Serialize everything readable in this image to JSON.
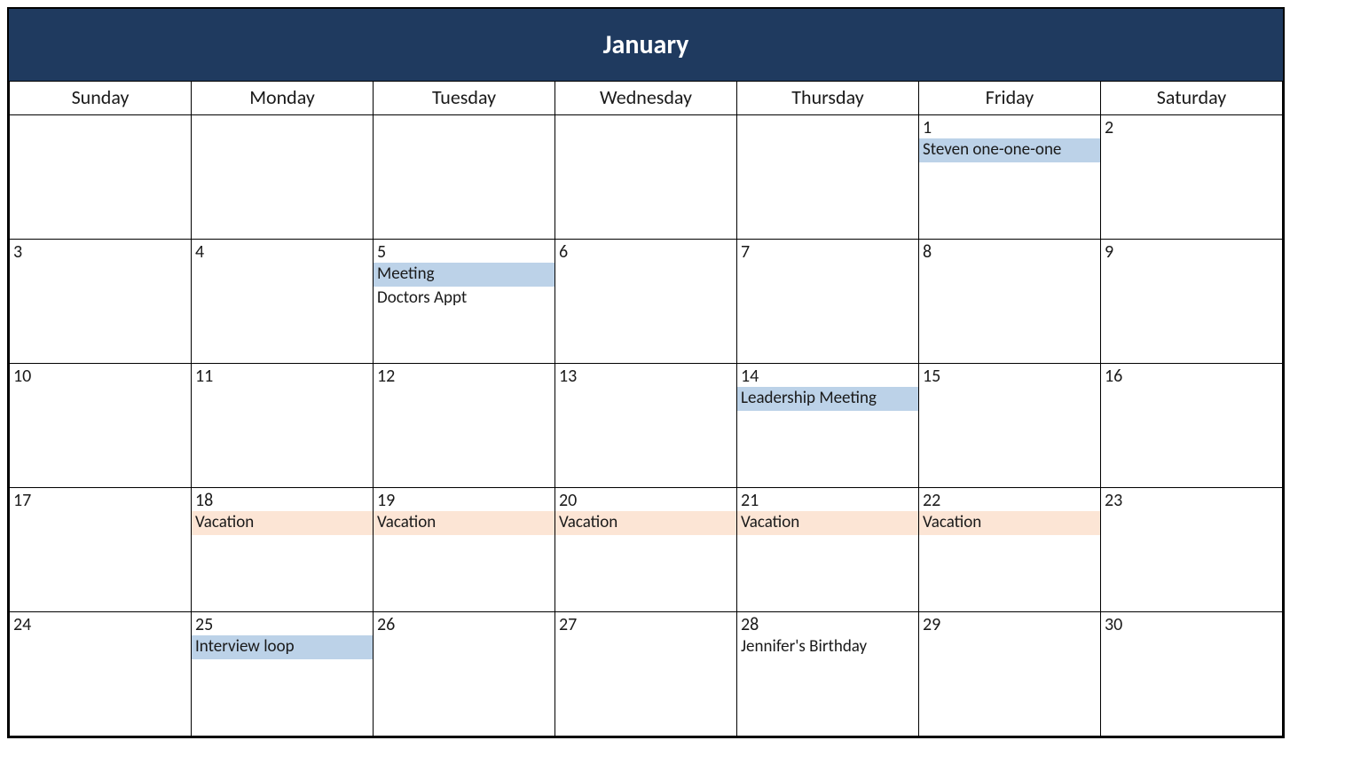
{
  "month": "January",
  "weekdays": [
    "Sunday",
    "Monday",
    "Tuesday",
    "Wednesday",
    "Thursday",
    "Friday",
    "Saturday"
  ],
  "colors": {
    "header_bg": "#1f3a5f",
    "event_blue": "#bcd2e8",
    "event_orange": "#fce5d5"
  },
  "weeks": [
    [
      {
        "day": "",
        "events": []
      },
      {
        "day": "",
        "events": []
      },
      {
        "day": "",
        "events": []
      },
      {
        "day": "",
        "events": []
      },
      {
        "day": "",
        "events": []
      },
      {
        "day": "1",
        "events": [
          {
            "label": "Steven one-one-one",
            "color": "blue"
          }
        ]
      },
      {
        "day": "2",
        "events": []
      }
    ],
    [
      {
        "day": "3",
        "events": []
      },
      {
        "day": "4",
        "events": []
      },
      {
        "day": "5",
        "events": [
          {
            "label": "Meeting",
            "color": "blue"
          },
          {
            "label": "Doctors Appt",
            "color": ""
          }
        ]
      },
      {
        "day": "6",
        "events": []
      },
      {
        "day": "7",
        "events": []
      },
      {
        "day": "8",
        "events": []
      },
      {
        "day": "9",
        "events": []
      }
    ],
    [
      {
        "day": "10",
        "events": []
      },
      {
        "day": "11",
        "events": []
      },
      {
        "day": "12",
        "events": []
      },
      {
        "day": "13",
        "events": []
      },
      {
        "day": "14",
        "events": [
          {
            "label": "Leadership Meeting",
            "color": "blue"
          }
        ]
      },
      {
        "day": "15",
        "events": []
      },
      {
        "day": "16",
        "events": []
      }
    ],
    [
      {
        "day": "17",
        "events": []
      },
      {
        "day": "18",
        "events": [
          {
            "label": "Vacation",
            "color": "orange"
          }
        ]
      },
      {
        "day": "19",
        "events": [
          {
            "label": "Vacation",
            "color": "orange"
          }
        ]
      },
      {
        "day": "20",
        "events": [
          {
            "label": "Vacation",
            "color": "orange"
          }
        ]
      },
      {
        "day": "21",
        "events": [
          {
            "label": "Vacation",
            "color": "orange"
          }
        ]
      },
      {
        "day": "22",
        "events": [
          {
            "label": "Vacation",
            "color": "orange"
          }
        ]
      },
      {
        "day": "23",
        "events": []
      }
    ],
    [
      {
        "day": "24",
        "events": []
      },
      {
        "day": "25",
        "events": [
          {
            "label": "Interview loop",
            "color": "blue"
          }
        ]
      },
      {
        "day": "26",
        "events": []
      },
      {
        "day": "27",
        "events": []
      },
      {
        "day": "28",
        "events": [
          {
            "label": "Jennifer's Birthday",
            "color": ""
          }
        ]
      },
      {
        "day": "29",
        "events": []
      },
      {
        "day": "30",
        "events": []
      }
    ]
  ]
}
